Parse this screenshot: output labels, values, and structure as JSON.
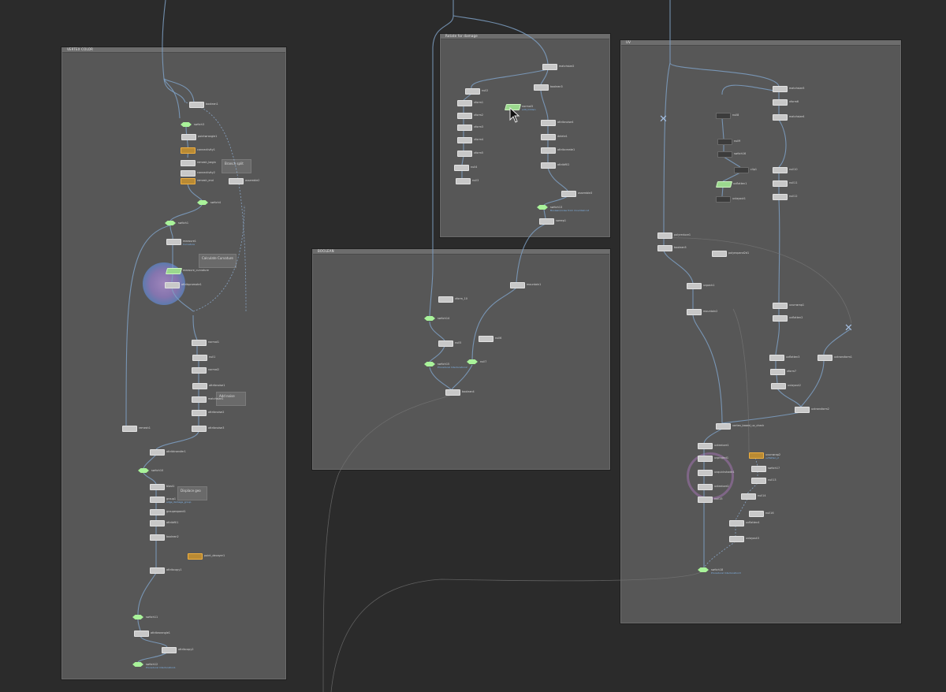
{
  "boxes": {
    "left": {
      "title": "VERTEX COLOR"
    },
    "top": {
      "title": "Rotate for damage"
    },
    "mid": {
      "title": "BOOLEAN"
    },
    "right": {
      "title": "UV"
    }
  },
  "notes": {
    "n1": "Branch split",
    "n2": "Calculate Curvature",
    "n3": "Add noise",
    "n4": "Displace geo"
  },
  "left_nodes": [
    "boolean1",
    "switch3",
    "pointwrangle1",
    "connectivity1",
    "remesh_begin",
    "connectivity2",
    "remesh_end",
    "assemble2",
    "switch4",
    "switch1",
    "measure1",
    "measure_curvature",
    "attribpromote1",
    "normal1",
    "null1",
    "normal2",
    "attribnoise1",
    "matchsize1",
    "attribnoise2",
    "attribnoise3",
    "remesh1",
    "attribtransfer1",
    "switch10",
    "blast1",
    "group1",
    "groupexpand1",
    "attribfill1",
    "boolean2",
    "point_decayer1",
    "attribcopy1",
    "switch11",
    "attribwrangle1",
    "attribcopy2",
    "switch12"
  ],
  "left_subs": {
    "measure1": "Curvature",
    "group1": "edge_damage_group",
    "switch12": "Procedural Interlocation1"
  },
  "top_nodes": [
    "matchsize2",
    "boolean3",
    "normal3",
    "null2",
    "xform1",
    "xform2",
    "xform3",
    "xform4",
    "xform5",
    "null3",
    "attribnoise4",
    "delete1",
    "attribcreate1",
    "attribfill2",
    "assemble3",
    "switch13",
    "sweep1",
    "null4"
  ],
  "top_subs": {
    "normal3": "edit_hidden",
    "switch13": "Boolean/noise from mountaincut"
  },
  "mid_nodes": [
    "mountain1",
    "switch14",
    "xform_10",
    "switch15",
    "null5",
    "null6",
    "null7",
    "boolean4"
  ],
  "mid_subs": {
    "switch15": "Procedural Interlocation2"
  },
  "right_nodes": [
    "matchsize3",
    "xform6",
    "matchsize4",
    "null8",
    "null9",
    "switch16",
    "clip1",
    "uvflatten1",
    "uvlayout1",
    "null10",
    "null11",
    "null12",
    "polyreduce1",
    "boolean5",
    "polyexpand2d1",
    "uvpack1",
    "mountain2",
    "uvunwrap1",
    "uvflatten2",
    "uvflatten3",
    "xform7",
    "uvlayout2",
    "uvtransform1",
    "uvtransform2",
    "vertex_based_uv_check",
    "uvunwrap2",
    "uvtexture1",
    "uvproject1",
    "uvquickshade1",
    "uvtexture2",
    "switch17",
    "null13",
    "null14",
    "uvflatten4",
    "uvlayout3",
    "switch18",
    "null15",
    "null16"
  ],
  "right_subs": {
    "switch18": "Procedural Interlocation3",
    "uvunwrap2": "uvflatten_2"
  },
  "colors": {
    "background": "#2b2b2b",
    "box": "#575757",
    "wire": "#7ea0c4",
    "switch": "#a9f39a",
    "accent_orange": "#f0b040",
    "selection_ring": "#a58bc8"
  }
}
